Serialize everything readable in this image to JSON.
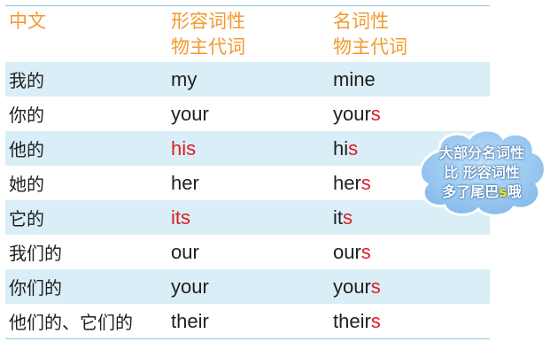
{
  "header": {
    "col1": "中文",
    "col2_line1": "形容词性",
    "col2_line2": "物主代词",
    "col3_line1": "名词性",
    "col3_line2": "物主代词"
  },
  "rows": [
    {
      "zh": "我的",
      "adj": "my",
      "noun_stem": "mine",
      "noun_suffix": ""
    },
    {
      "zh": "你的",
      "adj": "your",
      "noun_stem": "your",
      "noun_suffix": "s"
    },
    {
      "zh": "他的",
      "adj": "his",
      "noun_stem": "hi",
      "noun_suffix": "s"
    },
    {
      "zh": "她的",
      "adj": "her",
      "noun_stem": "her",
      "noun_suffix": "s"
    },
    {
      "zh": "它的",
      "adj": "its",
      "noun_stem": "it",
      "noun_suffix": "s"
    },
    {
      "zh": "我们的",
      "adj": "our",
      "noun_stem": "our",
      "noun_suffix": "s"
    },
    {
      "zh": "你们的",
      "adj": "your",
      "noun_stem": "your",
      "noun_suffix": "s"
    },
    {
      "zh": "他们的、它们的",
      "adj": "their",
      "noun_stem": "their",
      "noun_suffix": "s"
    }
  ],
  "cloud": {
    "line1": "大部分名词性",
    "line2": "比 形容词性",
    "line3_prefix": "多了尾巴",
    "line3_highlight": "s",
    "line3_suffix": "哦"
  },
  "colors": {
    "header_text": "#f29a2e",
    "highlight_red": "#e01b24",
    "row_shade": "#d9eef6",
    "cloud_fill": "#8ec3ee"
  }
}
